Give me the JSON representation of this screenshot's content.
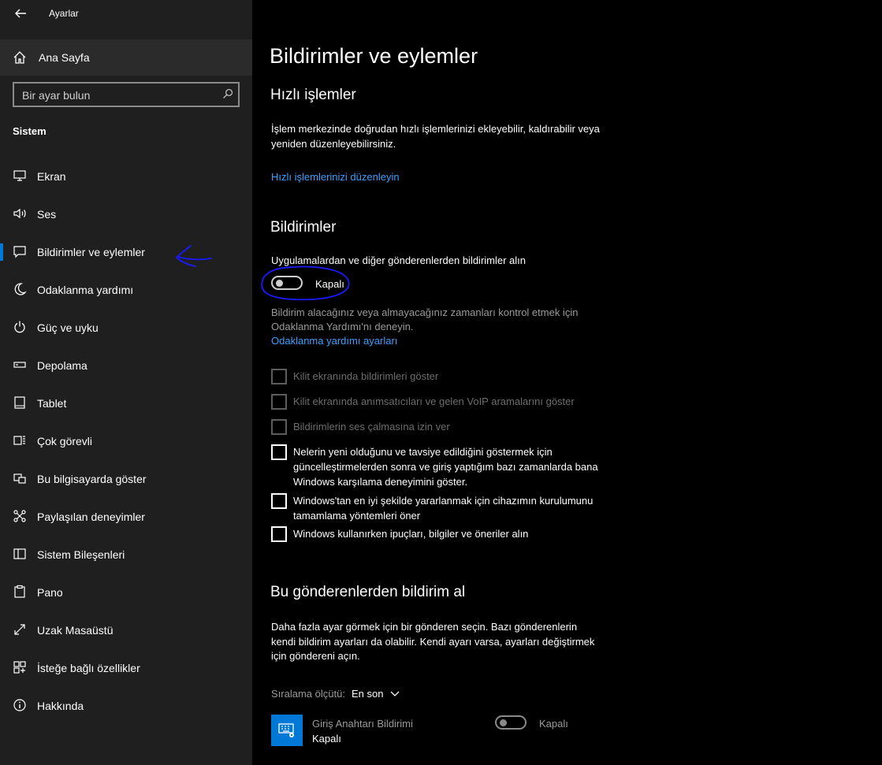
{
  "app_title": "Ayarlar",
  "home_label": "Ana Sayfa",
  "search": {
    "placeholder": "Bir ayar bulun"
  },
  "section_label": "Sistem",
  "nav": [
    {
      "label": "Ekran",
      "icon": "monitor-icon"
    },
    {
      "label": "Ses",
      "icon": "speaker-icon"
    },
    {
      "label": "Bildirimler ve eylemler",
      "icon": "notification-icon",
      "active": true
    },
    {
      "label": "Odaklanma yardımı",
      "icon": "moon-icon"
    },
    {
      "label": "Güç ve uyku",
      "icon": "power-icon"
    },
    {
      "label": "Depolama",
      "icon": "storage-icon"
    },
    {
      "label": "Tablet",
      "icon": "tablet-icon"
    },
    {
      "label": "Çok görevli",
      "icon": "multitask-icon"
    },
    {
      "label": "Bu bilgisayarda göster",
      "icon": "project-icon"
    },
    {
      "label": "Paylaşılan deneyimler",
      "icon": "share-icon"
    },
    {
      "label": "Sistem Bileşenleri",
      "icon": "components-icon"
    },
    {
      "label": "Pano",
      "icon": "clipboard-icon"
    },
    {
      "label": "Uzak Masaüstü",
      "icon": "remote-desktop-icon"
    },
    {
      "label": "İsteğe bağlı özellikler",
      "icon": "optional-features-icon"
    },
    {
      "label": "Hakkında",
      "icon": "info-icon"
    }
  ],
  "main": {
    "title": "Bildirimler ve eylemler",
    "quick": {
      "heading": "Hızlı işlemler",
      "desc_1": "İşlem merkezinde doğrudan hızlı işlemlerinizi ekleyebilir, kaldırabilir veya",
      "desc_2": "yeniden düzenleyebilirsiniz.",
      "link": "Hızlı işlemlerinizi düzenleyin"
    },
    "notifications": {
      "heading": "Bildirimler",
      "toggle_caption": "Uygulamalardan ve diğer gönderenlerden bildirimler alın",
      "toggle_state": "Kapalı",
      "focus_text_1": "Bildirim alacağınız veya almayacağınız zamanları kontrol etmek için",
      "focus_text_2": "Odaklanma Yardımı'nı deneyin.",
      "focus_link": "Odaklanma yardımı ayarları",
      "checkboxes": [
        {
          "lines": [
            "Kilit ekranında bildirimleri göster"
          ],
          "disabled": true
        },
        {
          "lines": [
            "Kilit ekranında anımsatıcıları ve gelen VoIP aramalarını göster"
          ],
          "disabled": true
        },
        {
          "lines": [
            "Bildirimlerin ses çalmasına izin ver"
          ],
          "disabled": true
        },
        {
          "lines": [
            "Nelerin yeni olduğunu ve tavsiye edildiğini göstermek için",
            "güncelleştirmelerden sonra ve giriş yaptığım bazı zamanlarda bana",
            "Windows karşılama deneyimini göster."
          ],
          "disabled": false
        },
        {
          "lines": [
            "Windows'tan en iyi şekilde yararlanmak için cihazımın kurulumunu",
            "tamamlama yöntemleri öner"
          ],
          "disabled": false
        },
        {
          "lines": [
            "Windows kullanırken ipuçları, bilgiler ve öneriler alın"
          ],
          "disabled": false
        }
      ]
    },
    "senders": {
      "heading": "Bu gönderenlerden bildirim al",
      "desc_1": "Daha fazla ayar görmek için bir gönderen seçin. Bazı gönderenlerin",
      "desc_2": "kendi bildirim ayarları da olabilir. Kendi ayarı varsa, ayarları değiştirmek",
      "desc_3": "için göndereni açın.",
      "sort_label": "Sıralama ölçütü:",
      "sort_value": "En son",
      "app_name": "Giriş Anahtarı Bildirimi",
      "app_status": "Kapalı",
      "app_toggle_state": "Kapalı"
    }
  },
  "colors": {
    "accent": "#0078d7",
    "link": "#3aa0ff",
    "annotation": "#1a1aff"
  }
}
